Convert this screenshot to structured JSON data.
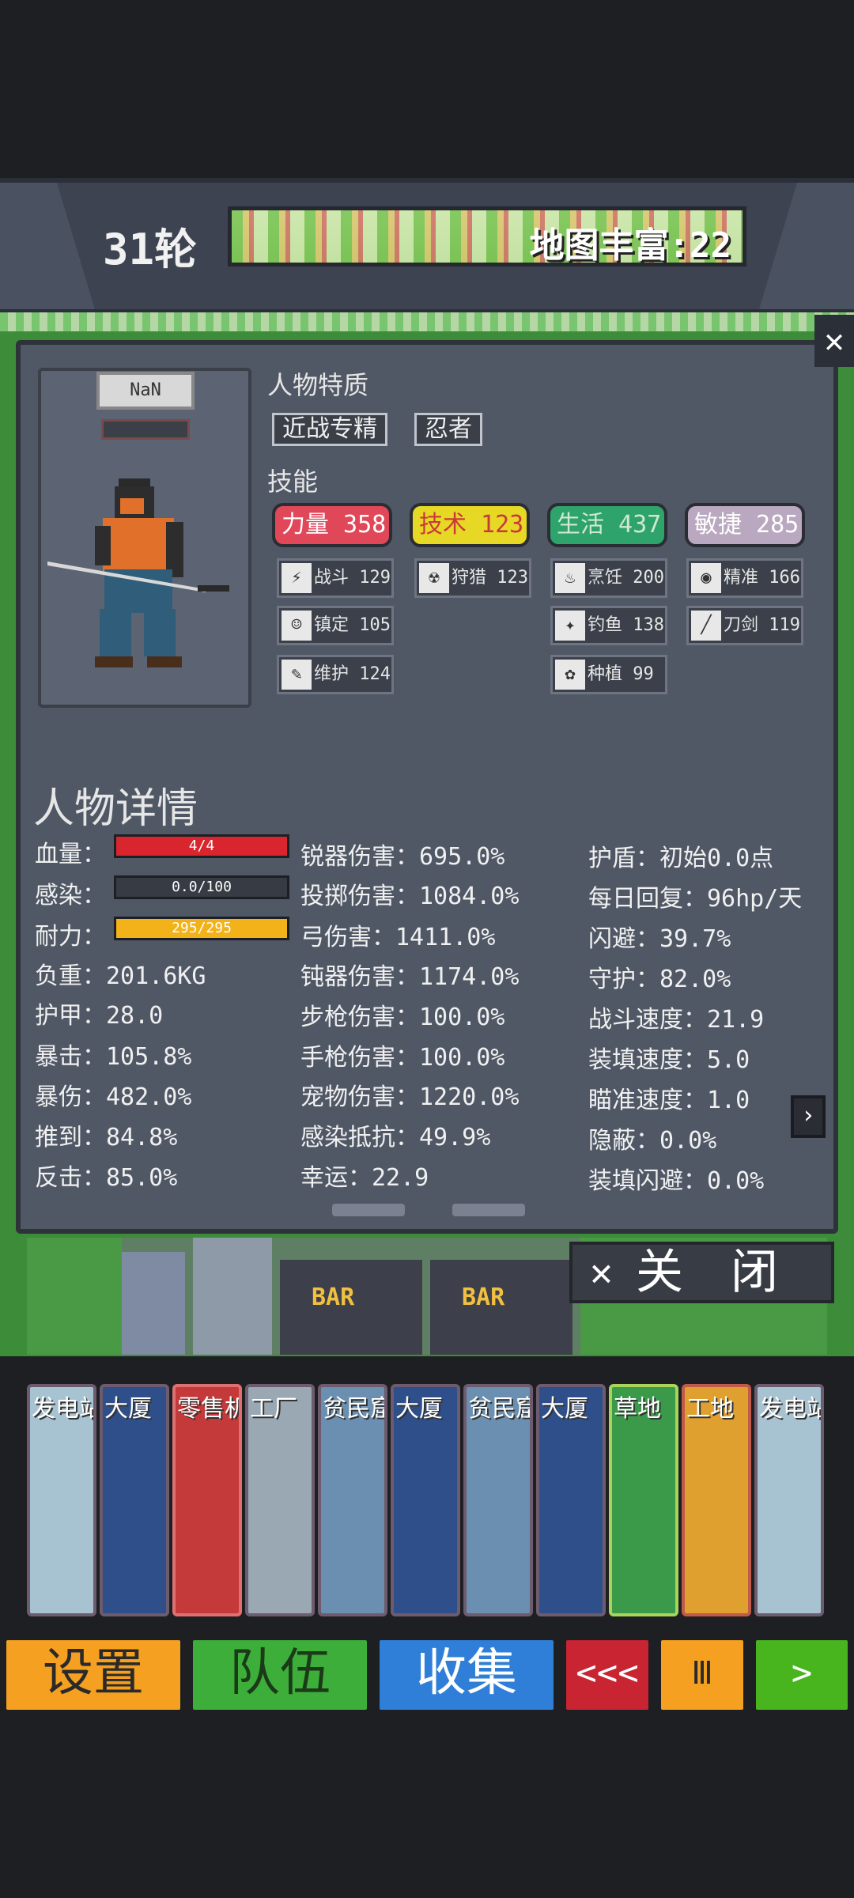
{
  "header": {
    "round": "31轮",
    "map_richness": "地图丰富:22"
  },
  "character": {
    "name": "NaN",
    "traits_title": "人物特质",
    "traits": [
      "近战专精",
      "忍者"
    ],
    "skills_title": "技能",
    "attributes": [
      {
        "label": "力量 358",
        "color": "#e0485a"
      },
      {
        "label": "技术 123",
        "color": "#e6d824"
      },
      {
        "label": "生活 437",
        "color": "#2ea36c"
      },
      {
        "label": "敏捷 285",
        "color": "#b9a8bf"
      }
    ],
    "skill_list": [
      {
        "label": "战斗 129",
        "icon": "lightning-icon"
      },
      {
        "label": "狩猎 123",
        "icon": "radiation-icon"
      },
      {
        "label": "烹饪 200",
        "icon": "cooking-icon"
      },
      {
        "label": "精准 166",
        "icon": "eye-icon"
      },
      {
        "label": "镇定 105",
        "icon": "mask-icon"
      },
      {
        "label": "钓鱼 138",
        "icon": "fish-icon"
      },
      {
        "label": "刀剑 119",
        "icon": "sword-icon"
      },
      {
        "label": "维护 124",
        "icon": "wrench-icon"
      },
      {
        "label": "种植 99",
        "icon": "plant-icon"
      }
    ]
  },
  "details": {
    "title": "人物详情",
    "hp_label": "血量：",
    "hp_text": "4/4",
    "hp_fraction": 1.0,
    "infect_label": "感染：",
    "infect_text": "0.0/100",
    "infect_fraction": 0.0,
    "stamina_label": "耐力：",
    "stamina_text": "295/295",
    "stamina_fraction": 1.0,
    "col1": [
      "负重：201.6KG",
      "护甲：28.0",
      "暴击：105.8%",
      "暴伤：482.0%",
      "推到：84.8%",
      "反击：85.0%"
    ],
    "col2": [
      "锐器伤害：695.0%",
      "投掷伤害：1084.0%",
      "弓伤害：1411.0%",
      "钝器伤害：1174.0%",
      "步枪伤害：100.0%",
      "手枪伤害：100.0%",
      "宠物伤害：1220.0%",
      "感染抵抗：49.9%",
      "幸运：22.9"
    ],
    "col3": [
      "护盾：初始0.0点",
      "每日回复：96hp/天",
      "闪避：39.7%",
      "守护：82.0%",
      "战斗速度：21.9",
      "装填速度：5.0",
      "瞄准速度：1.0",
      "隐蔽：0.0%",
      "装填闪避：0.0%"
    ]
  },
  "close_label": "关　闭",
  "bar_signs": [
    "BAR",
    "BAR"
  ],
  "cards": [
    "发电站",
    "大厦",
    "零售机",
    "工厂",
    "贫民窟",
    "大厦",
    "贫民窟",
    "大厦",
    "草地",
    "工地",
    "发电站"
  ],
  "buttons": {
    "settings": "设置",
    "team": "队伍",
    "collect": "收集",
    "rewind": "<<<",
    "pause": "Ⅲ",
    "play": ">"
  }
}
